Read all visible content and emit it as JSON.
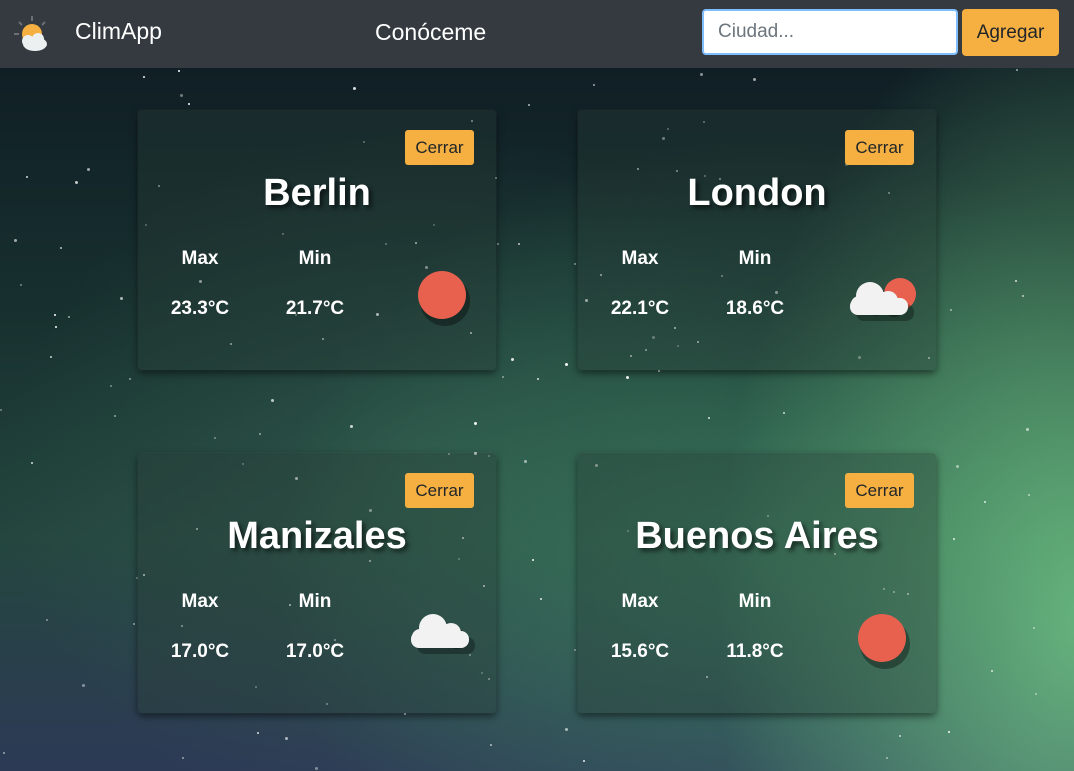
{
  "app": {
    "brand": "ClimApp",
    "nav_link": "Conóceme",
    "search": {
      "placeholder": "Ciudad...",
      "value": ""
    },
    "add_label": "Agregar"
  },
  "labels": {
    "max": "Max",
    "min": "Min",
    "close": "Cerrar"
  },
  "cities": [
    {
      "name": "Berlin",
      "max": "23.3°C",
      "min": "21.7°C",
      "icon": "sun-icon"
    },
    {
      "name": "London",
      "max": "22.1°C",
      "min": "18.6°C",
      "icon": "sun-cloud-icon"
    },
    {
      "name": "Manizales",
      "max": "17.0°C",
      "min": "17.0°C",
      "icon": "cloud-icon"
    },
    {
      "name": "Buenos Aires",
      "max": "15.6°C",
      "min": "11.8°C",
      "icon": "sun-icon"
    }
  ],
  "colors": {
    "accent": "#f5b041",
    "sun": "#e8614f",
    "navbar": "#343a40"
  }
}
